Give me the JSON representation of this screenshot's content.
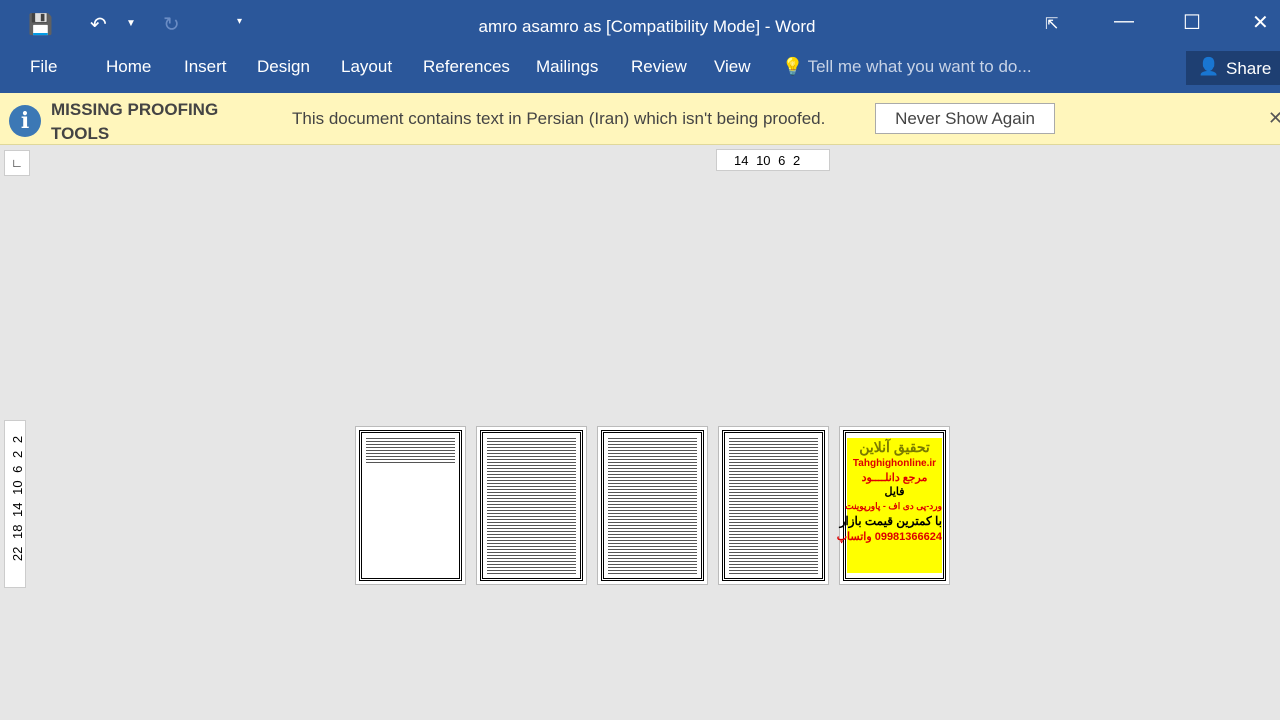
{
  "window": {
    "title": "amro asamro as [Compatibility Mode] - Word"
  },
  "ribbon": {
    "tabs": [
      "File",
      "Home",
      "Insert",
      "Design",
      "Layout",
      "References",
      "Mailings",
      "Review",
      "View"
    ],
    "tell_me": "Tell me what you want to do...",
    "share": "Share"
  },
  "message_bar": {
    "title": "MISSING PROOFING TOOLS",
    "text": "This document contains text in Persian (Iran) which isn't being proofed.",
    "button": "Never Show Again"
  },
  "rulers": {
    "horizontal": "14 10 6 2",
    "vertical": "22 18 14 10 6 2 2"
  },
  "pages": {
    "ad": {
      "title": "تحقیق آنلاین",
      "site": "Tahghighonline.ir",
      "l1": "مرجع دانلــــود",
      "l2": "فایل",
      "l3": "ورد-پی دی اف - پاورپوینت",
      "l4": "با کمترین قیمت بازار",
      "l5": "09981366624 واتساپ"
    }
  }
}
